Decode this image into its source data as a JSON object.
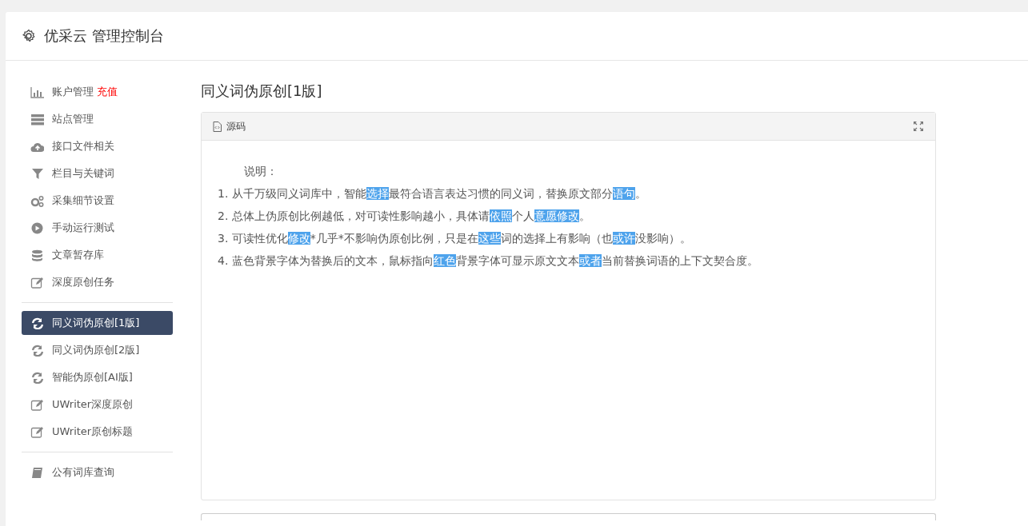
{
  "header": {
    "title": "优采云 管理控制台"
  },
  "sidebar": {
    "groups": [
      {
        "items": [
          {
            "label": "账户管理",
            "badge": "充值",
            "selected": false
          },
          {
            "label": "站点管理",
            "selected": false
          },
          {
            "label": "接口文件相关",
            "selected": false
          },
          {
            "label": "栏目与关键词",
            "selected": false
          },
          {
            "label": "采集细节设置",
            "selected": false
          },
          {
            "label": "手动运行测试",
            "selected": false
          },
          {
            "label": "文章暂存库",
            "selected": false
          },
          {
            "label": "深度原创任务",
            "selected": false
          }
        ]
      },
      {
        "items": [
          {
            "label": "同义词伪原创[1版]",
            "selected": true
          },
          {
            "label": "同义词伪原创[2版]",
            "selected": false
          },
          {
            "label": "智能伪原创[AI版]",
            "selected": false
          },
          {
            "label": "UWriter深度原创",
            "selected": false
          },
          {
            "label": "UWriter原创标题",
            "selected": false
          }
        ]
      },
      {
        "items": [
          {
            "label": "公有词库查询",
            "selected": false
          }
        ]
      }
    ]
  },
  "main": {
    "title": "同义词伪原创[1版]",
    "editor": {
      "toolbar_label": "源码",
      "heading": "说明：",
      "lines": [
        [
          {
            "text": "1. 从千万级同义词库中，智能",
            "highlight": false
          },
          {
            "text": "选择",
            "highlight": true
          },
          {
            "text": "最符合语言表达习惯的同义词，替换原文部分",
            "highlight": false
          },
          {
            "text": "语句",
            "highlight": true
          },
          {
            "text": "。",
            "highlight": false
          }
        ],
        [
          {
            "text": "2. 总体上伪原创比例越低，对可读性影响越小，具体请",
            "highlight": false
          },
          {
            "text": "依照",
            "highlight": true
          },
          {
            "text": "个人",
            "highlight": false
          },
          {
            "text": "意愿",
            "highlight": true
          },
          {
            "text": "修改",
            "highlight": true
          },
          {
            "text": "。",
            "highlight": false
          }
        ],
        [
          {
            "text": "3. 可读性优化",
            "highlight": false
          },
          {
            "text": "修改",
            "highlight": true
          },
          {
            "text": "*几乎*不影响伪原创比例，只是在",
            "highlight": false
          },
          {
            "text": "这些",
            "highlight": true
          },
          {
            "text": "词的选择上有影响（也",
            "highlight": false
          },
          {
            "text": "或许",
            "highlight": true
          },
          {
            "text": "没影响）。",
            "highlight": false
          }
        ],
        [
          {
            "text": "4. 蓝色背景字体为替换后的文本，鼠标指向",
            "highlight": false
          },
          {
            "text": "红色",
            "highlight": true
          },
          {
            "text": "背景字体可显示原文文本",
            "highlight": false
          },
          {
            "text": "或者",
            "highlight": true
          },
          {
            "text": "当前替换词语的上下文契合度。",
            "highlight": false
          }
        ]
      ]
    }
  }
}
